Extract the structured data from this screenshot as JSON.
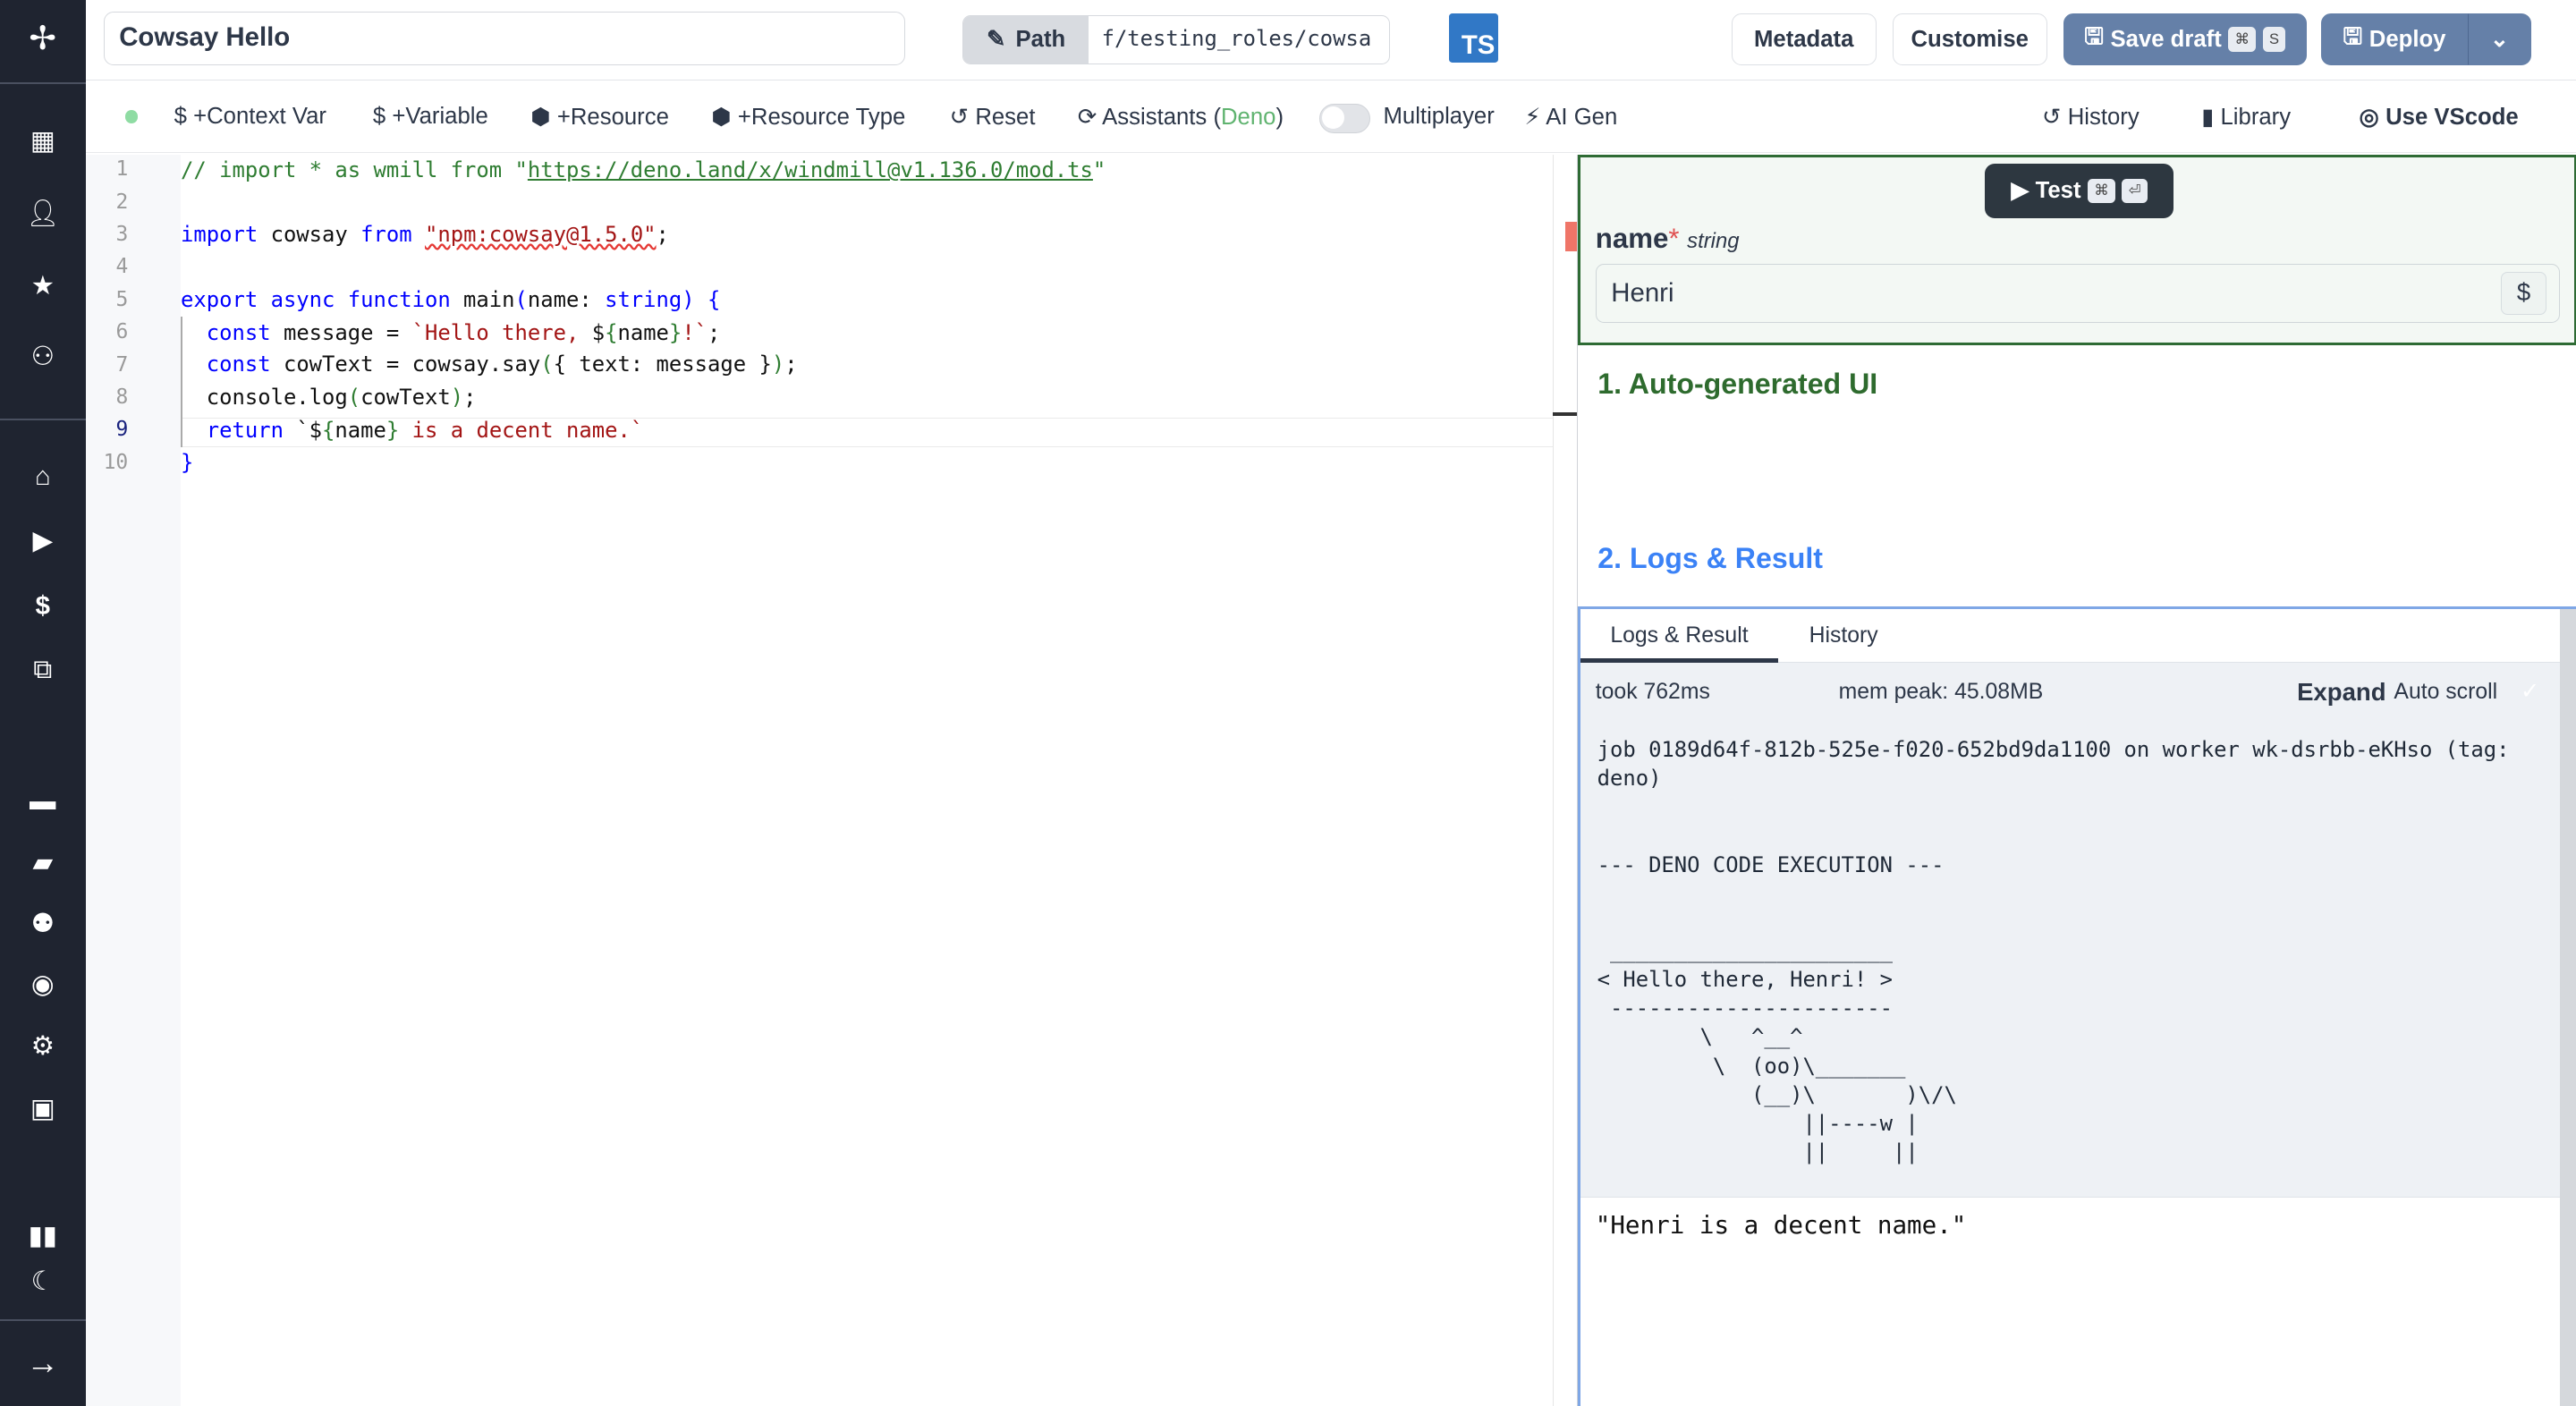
{
  "sidebar": {
    "icons": [
      "windmill-logo",
      "building-icon",
      "user-icon",
      "star-icon",
      "users-icon",
      "home-icon",
      "play-icon",
      "dollar-icon",
      "cubes-icon",
      "calendar-icon",
      "folder-icon",
      "user-cog-icon",
      "eye-icon",
      "gear-icon",
      "robot-icon",
      "book-icon",
      "moon-icon",
      "arrow-right-icon"
    ]
  },
  "header": {
    "title": "Cowsay Hello",
    "path_label": "Path",
    "path_value": "f/testing_roles/cowsa",
    "lang_badge": "TS",
    "metadata": "Metadata",
    "customise": "Customise",
    "save_draft": "Save draft",
    "save_kbd1": "⌘",
    "save_kbd2": "S",
    "deploy": "Deploy"
  },
  "toolbar": {
    "context_var": "+Context Var",
    "variable": "+Variable",
    "resource": "+Resource",
    "resource_type": "+Resource Type",
    "reset": "Reset",
    "assistants": "Assistants",
    "assistants_lang": "Deno",
    "multiplayer": "Multiplayer",
    "multiplayer_on": false,
    "ai_gen": "AI Gen",
    "history": "History",
    "library": "Library",
    "vscode": "Use VScode"
  },
  "editor": {
    "line_numbers": [
      "1",
      "2",
      "3",
      "4",
      "5",
      "6",
      "7",
      "8",
      "9",
      "10"
    ],
    "active_line": 9
  },
  "test": {
    "button": "Test",
    "kbd1": "⌘",
    "kbd2": "⏎",
    "field_name": "name",
    "required": "*",
    "field_type": "string",
    "field_value": "Henri",
    "dollar": "$"
  },
  "sections": {
    "auto_ui": "1. Auto-generated UI",
    "logs_result": "2. Logs & Result"
  },
  "logs": {
    "tabs": [
      "Logs & Result",
      "History"
    ],
    "active_tab": 0,
    "took": "took 762ms",
    "mem": "mem peak: 45.08MB",
    "expand": "Expand",
    "auto_scroll": "Auto scroll",
    "lines": [
      "job 0189d64f-812b-525e-f020-652bd9da1100 on worker wk-dsrbb-eKHso (tag:",
      "deno)",
      "",
      "",
      "--- DENO CODE EXECUTION ---",
      "",
      "",
      " ______________________",
      "< Hello there, Henri! >",
      " ----------------------",
      "        \\   ^__^",
      "         \\  (oo)\\_______",
      "            (__)\\       )\\/\\",
      "                ||----w |",
      "                ||     ||"
    ],
    "result": "\"Henri is a decent name.\""
  }
}
